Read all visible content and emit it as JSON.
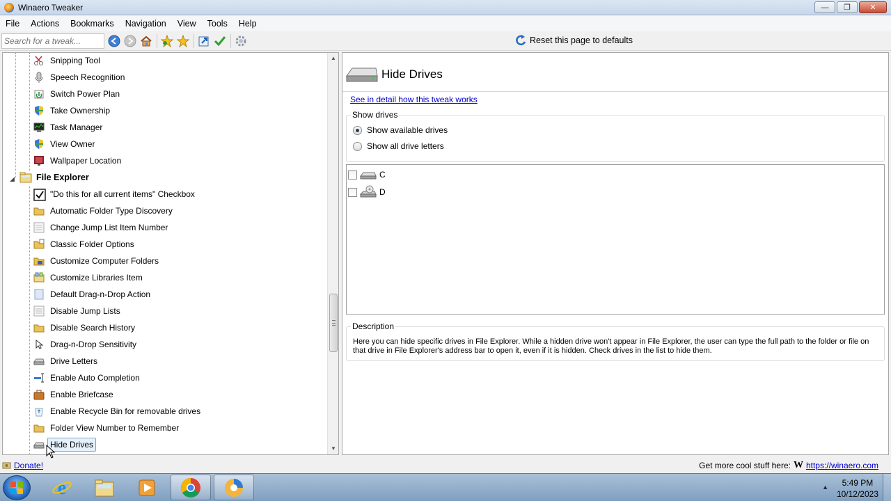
{
  "window": {
    "title": "Winaero Tweaker"
  },
  "menu": [
    "File",
    "Actions",
    "Bookmarks",
    "Navigation",
    "View",
    "Tools",
    "Help"
  ],
  "toolbar": {
    "search_placeholder": "Search for a tweak...",
    "reset_label": "Reset this page to defaults",
    "icons": [
      "back-icon",
      "forward-icon",
      "home-icon",
      "add-bookmark-icon",
      "bookmarks-icon",
      "export-icon",
      "apply-icon",
      "settings-icon"
    ]
  },
  "tree": {
    "items_above": [
      {
        "label": "Snipping Tool",
        "icon": "scissors-icon"
      },
      {
        "label": "Speech Recognition",
        "icon": "microphone-icon"
      },
      {
        "label": "Switch Power Plan",
        "icon": "power-plan-icon"
      },
      {
        "label": "Take Ownership",
        "icon": "shield-icon"
      },
      {
        "label": "Task Manager",
        "icon": "task-manager-icon"
      },
      {
        "label": "View Owner",
        "icon": "shield-icon"
      },
      {
        "label": "Wallpaper Location",
        "icon": "wallpaper-icon"
      }
    ],
    "group": {
      "label": "File Explorer",
      "icon": "file-explorer-icon"
    },
    "group_items": [
      {
        "label": "\"Do this for all current items\" Checkbox",
        "icon": "checkbox-icon"
      },
      {
        "label": "Automatic Folder Type Discovery",
        "icon": "folder-icon"
      },
      {
        "label": "Change Jump List Item Number",
        "icon": "list-icon"
      },
      {
        "label": "Classic Folder Options",
        "icon": "folder-options-icon"
      },
      {
        "label": "Customize Computer Folders",
        "icon": "computer-folder-icon"
      },
      {
        "label": "Customize Libraries Item",
        "icon": "libraries-icon"
      },
      {
        "label": "Default Drag-n-Drop Action",
        "icon": "drag-drop-icon"
      },
      {
        "label": "Disable Jump Lists",
        "icon": "list-icon"
      },
      {
        "label": "Disable Search History",
        "icon": "folder-icon"
      },
      {
        "label": "Drag-n-Drop Sensitivity",
        "icon": "cursor-icon"
      },
      {
        "label": "Drive Letters",
        "icon": "drive-icon"
      },
      {
        "label": "Enable Auto Completion",
        "icon": "text-cursor-icon"
      },
      {
        "label": "Enable Briefcase",
        "icon": "briefcase-icon"
      },
      {
        "label": "Enable Recycle Bin for removable drives",
        "icon": "recycle-icon"
      },
      {
        "label": "Folder View Number to Remember",
        "icon": "folder-icon"
      },
      {
        "label": "Hide Drives",
        "icon": "drive-icon",
        "selected": true
      }
    ]
  },
  "page": {
    "title": "Hide Drives",
    "detail_link": "See in detail how this tweak works",
    "show_drives_caption": "Show drives",
    "options": [
      {
        "label": "Show available drives",
        "checked": true
      },
      {
        "label": "Show all drive letters",
        "checked": false
      }
    ],
    "drives": [
      {
        "letter": "C",
        "checked": false,
        "icon": "hard-drive-icon"
      },
      {
        "letter": "D",
        "checked": false,
        "icon": "optical-drive-icon"
      }
    ],
    "description_caption": "Description",
    "description": "Here you can hide specific drives in File Explorer. While a hidden drive won't appear in File Explorer, the user can type the full path to the folder or file on that drive in File Explorer's address bar to open it, even if it is hidden. Check drives in the list to hide them."
  },
  "status": {
    "donate": "Donate!",
    "more_text": "Get more cool stuff here:",
    "logo_letter": "W",
    "site": "https://winaero.com"
  },
  "taskbar": {
    "apps": [
      "internet-explorer-icon",
      "file-explorer-icon",
      "media-player-icon",
      "chrome-icon",
      "winaero-tweaker-icon"
    ],
    "time": "5:49 PM",
    "date": "10/12/2023"
  }
}
